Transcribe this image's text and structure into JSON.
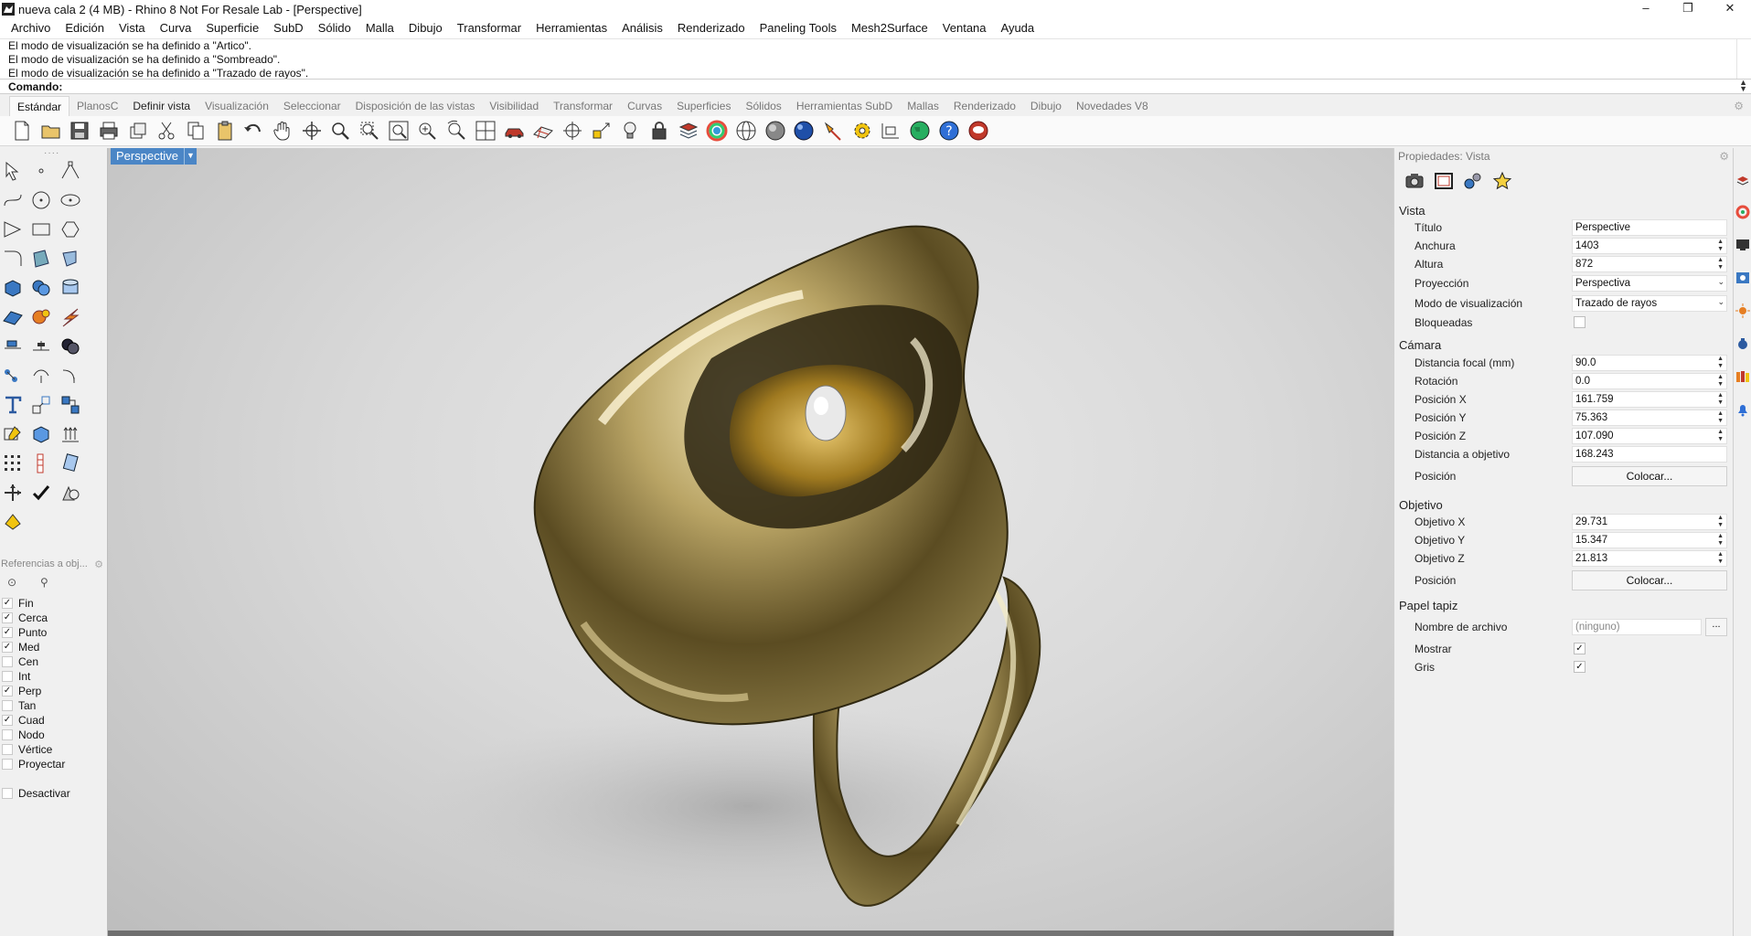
{
  "window": {
    "title": "nueva cala 2 (4 MB) - Rhino 8 Not For Resale Lab - [Perspective]",
    "minimize": "–",
    "maximize": "❐",
    "close": "✕"
  },
  "menu": [
    "Archivo",
    "Edición",
    "Vista",
    "Curva",
    "Superficie",
    "SubD",
    "Sólido",
    "Malla",
    "Dibujo",
    "Transformar",
    "Herramientas",
    "Análisis",
    "Renderizado",
    "Paneling Tools",
    "Mesh2Surface",
    "Ventana",
    "Ayuda"
  ],
  "history": [
    "El modo de visualización se ha definido a \"Artico\".",
    "El modo de visualización se ha definido a \"Sombreado\".",
    "El modo de visualización se ha definido a \"Trazado de rayos\"."
  ],
  "command": {
    "label": "Comando:"
  },
  "toolbar_tabs": [
    "Estándar",
    "PlanosC",
    "Definir vista",
    "Visualización",
    "Seleccionar",
    "Disposición de las vistas",
    "Visibilidad",
    "Transformar",
    "Curvas",
    "Superficies",
    "Sólidos",
    "Herramientas SubD",
    "Mallas",
    "Renderizado",
    "Dibujo",
    "Novedades V8"
  ],
  "active_toolbar_tab": "Estándar",
  "osnap": {
    "header": "Referencias a obj...",
    "items": [
      {
        "label": "Fin",
        "checked": true
      },
      {
        "label": "Cerca",
        "checked": true
      },
      {
        "label": "Punto",
        "checked": true
      },
      {
        "label": "Med",
        "checked": true
      },
      {
        "label": "Cen",
        "checked": false
      },
      {
        "label": "Int",
        "checked": false
      },
      {
        "label": "Perp",
        "checked": true
      },
      {
        "label": "Tan",
        "checked": false
      },
      {
        "label": "Cuad",
        "checked": true
      },
      {
        "label": "Nodo",
        "checked": false
      },
      {
        "label": "Vértice",
        "checked": false
      },
      {
        "label": "Proyectar",
        "checked": false
      }
    ],
    "disable": {
      "label": "Desactivar",
      "checked": false
    }
  },
  "viewport": {
    "name": "Perspective"
  },
  "properties": {
    "title": "Propiedades: Vista",
    "sections": {
      "vista": "Vista",
      "camara": "Cámara",
      "objetivo": "Objetivo",
      "papel": "Papel tapiz"
    },
    "vista": {
      "titulo": {
        "label": "Título",
        "value": "Perspective"
      },
      "anchura": {
        "label": "Anchura",
        "value": "1403"
      },
      "altura": {
        "label": "Altura",
        "value": "872"
      },
      "proyeccion": {
        "label": "Proyección",
        "value": "Perspectiva"
      },
      "modo": {
        "label": "Modo de visualización",
        "value": "Trazado de rayos"
      },
      "bloqueadas": {
        "label": "Bloqueadas",
        "checked": false
      }
    },
    "camara": {
      "focal": {
        "label": "Distancia focal (mm)",
        "value": "90.0"
      },
      "rotacion": {
        "label": "Rotación",
        "value": "0.0"
      },
      "posx": {
        "label": "Posición X",
        "value": "161.759"
      },
      "posy": {
        "label": "Posición Y",
        "value": "75.363"
      },
      "posz": {
        "label": "Posición Z",
        "value": "107.090"
      },
      "distancia": {
        "label": "Distancia a objetivo",
        "value": "168.243"
      },
      "posicion": {
        "label": "Posición",
        "button": "Colocar..."
      }
    },
    "objetivo": {
      "objx": {
        "label": "Objetivo X",
        "value": "29.731"
      },
      "objy": {
        "label": "Objetivo Y",
        "value": "15.347"
      },
      "objz": {
        "label": "Objetivo Z",
        "value": "21.813"
      },
      "posicion": {
        "label": "Posición",
        "button": "Colocar..."
      }
    },
    "papel": {
      "archivo": {
        "label": "Nombre de archivo",
        "value": "(ninguno)",
        "button": "..."
      },
      "mostrar": {
        "label": "Mostrar",
        "checked": true
      },
      "gris": {
        "label": "Gris",
        "checked": true
      }
    }
  },
  "colors": {
    "viewport_tab": "#4b86c6",
    "ring_gold": "#b8a060",
    "panel_bg": "#f0f0f0"
  }
}
